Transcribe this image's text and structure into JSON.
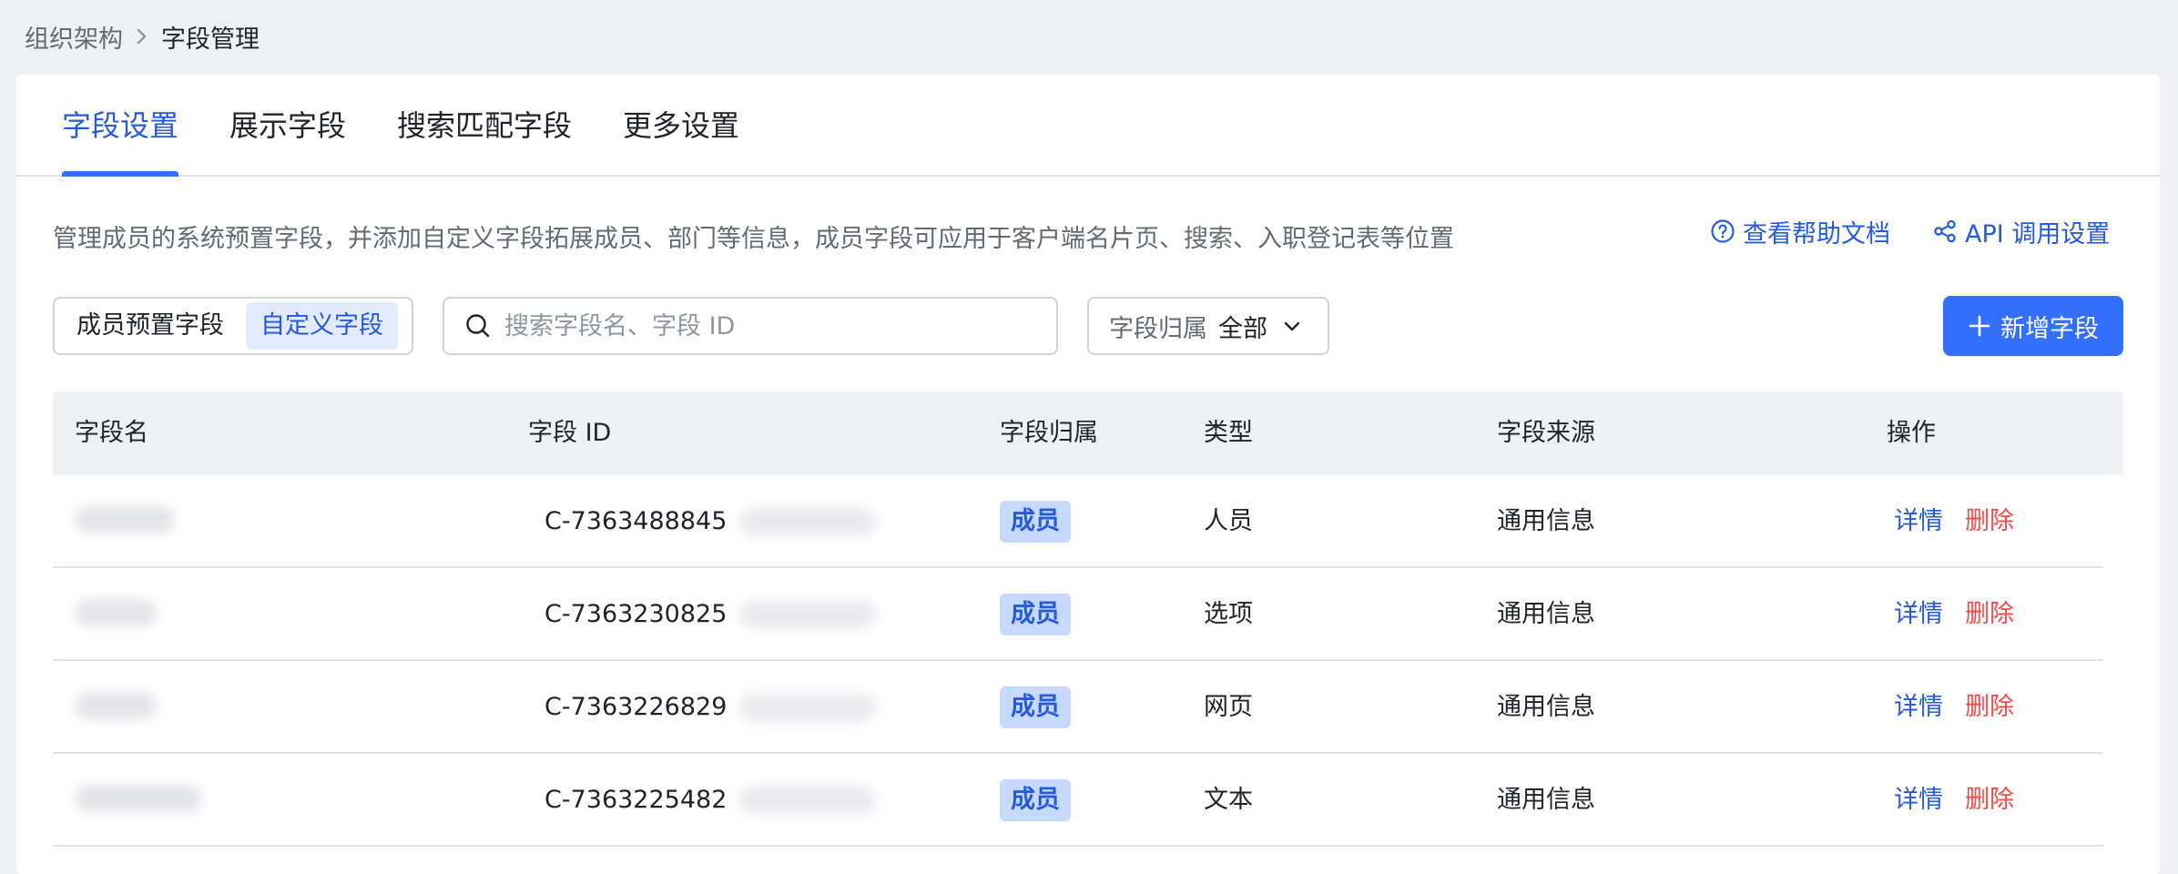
{
  "breadcrumb": {
    "parent": "组织架构",
    "current": "字段管理"
  },
  "tabs": [
    {
      "label": "字段设置",
      "active": true
    },
    {
      "label": "展示字段",
      "active": false
    },
    {
      "label": "搜索匹配字段",
      "active": false
    },
    {
      "label": "更多设置",
      "active": false
    }
  ],
  "description": "管理成员的系统预置字段，并添加自定义字段拓展成员、部门等信息，成员字段可应用于客户端名片页、搜索、入职登记表等位置",
  "help_link": {
    "label": "查看帮助文档",
    "icon": "question-circle-icon"
  },
  "api_link": {
    "label": "API 调用设置",
    "icon": "share-icon"
  },
  "segmented": {
    "options": [
      "成员预置字段",
      "自定义字段"
    ],
    "selected": "自定义字段"
  },
  "search": {
    "placeholder": "搜索字段名、字段 ID",
    "value": ""
  },
  "filter": {
    "label": "字段归属",
    "value": "全部"
  },
  "add_button": {
    "label": "新增字段"
  },
  "table": {
    "columns": [
      "字段名",
      "字段 ID",
      "字段归属",
      "类型",
      "字段来源",
      "操作"
    ],
    "rows": [
      {
        "name": "",
        "id": "C-7363488845",
        "owner": "成员",
        "type": "人员",
        "source": "通用信息",
        "detail": "详情",
        "delete": "删除"
      },
      {
        "name": "",
        "id": "C-7363230825",
        "owner": "成员",
        "type": "选项",
        "source": "通用信息",
        "detail": "详情",
        "delete": "删除"
      },
      {
        "name": "",
        "id": "C-7363226829",
        "owner": "成员",
        "type": "网页",
        "source": "通用信息",
        "detail": "详情",
        "delete": "删除"
      },
      {
        "name": "",
        "id": "C-7363225482",
        "owner": "成员",
        "type": "文本",
        "source": "通用信息",
        "detail": "详情",
        "delete": "删除"
      }
    ]
  },
  "colors": {
    "accent": "#3370FF",
    "link": "#245BDB",
    "danger": "#F54A45",
    "badge_bg": "#C8D9FF"
  }
}
